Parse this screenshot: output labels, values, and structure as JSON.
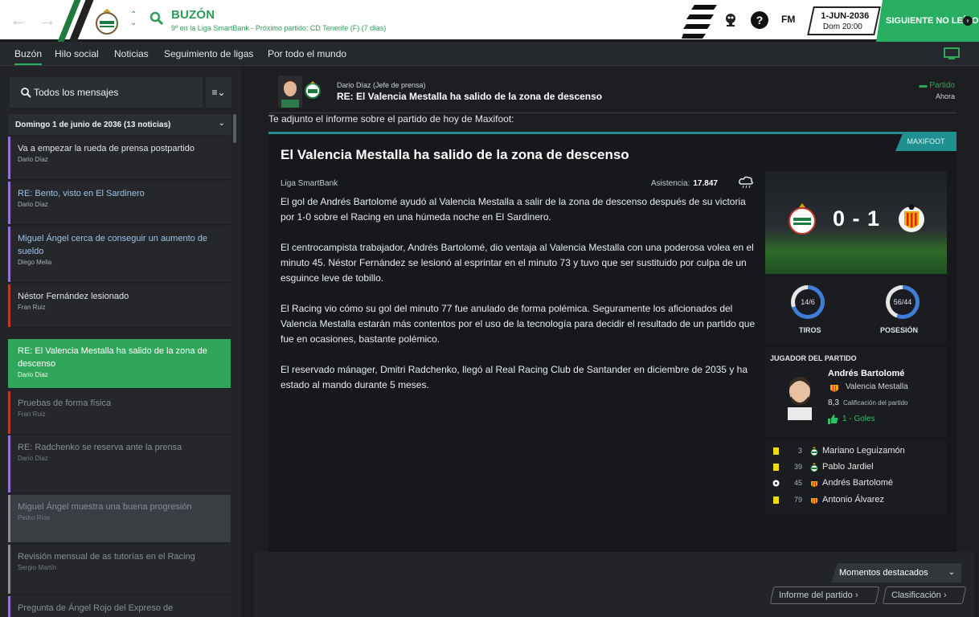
{
  "topbar": {
    "title": "BUZÓN",
    "subtitle": "9º en la Liga SmartBank - Próximo partido: CD Tenerife (F) (7 días)",
    "fm_label": "FM",
    "help_label": "?",
    "date": "1-JUN-2036",
    "time": "Dom 20:00",
    "next_button": "SIGUIENTE NO LEÍDO",
    "icons": [
      "back-arrow-icon",
      "forward-arrow-icon",
      "club-crest",
      "up-down-icon",
      "search-icon",
      "trophy-icon",
      "help-icon",
      "fm-logo",
      "next-icon"
    ]
  },
  "tabs": [
    "Buzón",
    "Hilo social",
    "Noticias",
    "Seguimiento de ligas",
    "Por todo el mundo"
  ],
  "sidebar": {
    "search_label": "Todos los mensajes",
    "filter_label": "≡⌄",
    "group_label": "Domingo 1 de junio de 2036 (13 noticias)",
    "messages": [
      {
        "title": "Va a empezar la rueda de prensa postpartido",
        "from": "Dario Díaz",
        "bar": "#9b6fd6",
        "state": "unread"
      },
      {
        "title": "RE: Bento, visto en El Sardinero",
        "from": "Dario Díaz",
        "bar": "#9b6fd6",
        "state": "blue"
      },
      {
        "title": "Miguel Ángel cerca de conseguir un aumento de sueldo",
        "from": "Diego Melia",
        "bar": "#9b6fd6",
        "state": "blue"
      },
      {
        "title": "Néstor Fernández lesionado",
        "from": "Fran Ruiz",
        "bar": "#c0392b",
        "state": "unread"
      },
      {
        "title": "RE: El Valencia Mestalla ha salido de la zona de descenso",
        "from": "Dario Díaz",
        "bar": "#2fa65a",
        "state": "selected"
      },
      {
        "title": "Pruebas de forma física",
        "from": "Fran Ruiz",
        "bar": "#c0392b",
        "state": "read"
      },
      {
        "title": "RE: Radchenko se reserva ante la prensa",
        "from": "Dario Díaz",
        "bar": "#9b6fd6",
        "state": "read"
      },
      {
        "title": "Miguel Ángel muestra una buena progresión",
        "from": "Pedro Ríos",
        "bar": "#8e8e8e",
        "state": "hover"
      },
      {
        "title": "Revisión mensual de as tutorías en el Racing",
        "from": "Sergio Martín",
        "bar": "#8e8e8e",
        "state": "read"
      },
      {
        "title": "Pregunta de Ángel Rojo del Expreso de",
        "from": "",
        "bar": "#9b6fd6",
        "state": "read"
      }
    ]
  },
  "message": {
    "sender": "Dario Díaz  (Jefe de prensa)",
    "title": "RE: El Valencia Mestalla ha salido de la zona de descenso",
    "status": "Partido",
    "time": "Ahora",
    "intro": "Te adjunto el informe sobre el partido de hoy de Maxifoot:"
  },
  "article": {
    "tag": "MAXIFOOT",
    "title": "El Valencia Mestalla ha salido de la zona de descenso",
    "league": "Liga SmartBank",
    "attendance_label": "Asistencia:",
    "attendance_value": "17.847",
    "paragraphs": [
      "El gol de Andrés Bartolomé ayudó al Valencia Mestalla a salir de la zona de descenso después de su victoria por 1-0 sobre el Racing en una húmeda noche en El Sardinero.",
      "El centrocampista trabajador, Andrés Bartolomé, dio ventaja al Valencia Mestalla con una poderosa volea en el minuto 45. Néstor Fernández se lesionó al esprintar en el minuto 73 y tuvo que ser sustituido por culpa de un esguince leve de tobillo.",
      "El Racing vio cómo su gol del minuto 77 fue anulado de forma polémica. Seguramente los aficionados del Valencia Mestalla estarán más contentos por el uso de la tecnología para decidir el resultado de un partido que fue en ocasiones, bastante polémico.",
      "El reservado mánager, Dmitri Radchenko, llegó al Real Racing Club de Santander en diciembre de 2035 y ha estado al mando durante 5 meses."
    ]
  },
  "match": {
    "score": "0 - 1",
    "shots": {
      "label": "TIROS",
      "value": "14/6",
      "home_share": 0.7
    },
    "possession": {
      "label": "POSESIÓN",
      "value": "56/44",
      "home_share": 0.56
    },
    "potm": {
      "heading": "JUGADOR DEL PARTIDO",
      "name": "Andrés Bartolomé",
      "club": "Valencia Mestalla",
      "rating": "8,3",
      "rating_label": "Calificación del partido",
      "goals": "1 - Goles"
    },
    "events": [
      {
        "type": "yellow-card",
        "minute": "3",
        "player": "Mariano Leguizamón",
        "club": "racing"
      },
      {
        "type": "yellow-card",
        "minute": "39",
        "player": "Pablo Jardiel",
        "club": "racing"
      },
      {
        "type": "goal",
        "minute": "45",
        "player": "Andrés Bartolomé",
        "club": "valencia"
      },
      {
        "type": "yellow-card",
        "minute": "79",
        "player": "Antonio Álvarez",
        "club": "valencia"
      }
    ]
  },
  "footer": {
    "moments": "Momentos destacados",
    "report": "Informe del partido",
    "table": "Clasificación"
  }
}
